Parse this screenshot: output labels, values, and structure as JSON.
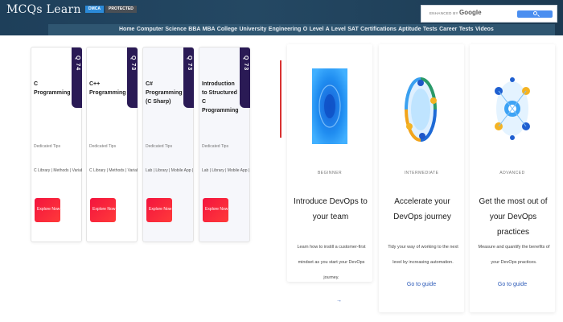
{
  "header": {
    "logo": "MCQs Learn",
    "badges": [
      "DMCA",
      "PROTECTED"
    ],
    "search_label": "ENHANCED BY",
    "search_brand": "Google",
    "nav": "Home Computer Science BBA MBA College University Engineering O Level A Level SAT Certifications Aptitude Tests Career Tests Videos"
  },
  "courses": [
    {
      "tag": "Q 74",
      "title": "C Programming",
      "meta1": "Dedicated Tips",
      "meta2": "C Library | Methods | Variables Lab",
      "button": "Explore Now"
    },
    {
      "tag": "Q 73",
      "title": "C++ Programming",
      "meta1": "Dedicated Tips",
      "meta2": "C Library | Methods | Variables Lab",
      "button": "Explore Now"
    },
    {
      "tag": "Q 73",
      "title": "C# Programming (C Sharp)",
      "meta1": "Dedicated Tips",
      "meta2": "Lab | Library | Mobile App | Web Tips",
      "button": "Explore Now"
    },
    {
      "tag": "Q 73",
      "title": "Introduction to Structured C Programming",
      "meta1": "Dedicated Tips",
      "meta2": "Lab | Library | Mobile App | Web Tips",
      "button": "Explore Now"
    }
  ],
  "guides": [
    {
      "level": "BEGINNER",
      "title": "Introduce DevOps to your team",
      "desc": "Learn how to instill a customer-first mindset as you start your DevOps journey.",
      "link": ""
    },
    {
      "level": "INTERMEDIATE",
      "title": "Accelerate your DevOps journey",
      "desc": "Tidy your way of working to the next level by increasing automation.",
      "link": "Go to guide"
    },
    {
      "level": "ADVANCED",
      "title": "Get the most out of your DevOps practices",
      "desc": "Measure and quantify the benefits of your DevOps practices.",
      "link": "Go to guide"
    }
  ],
  "more_link": "→",
  "colors": {
    "header": "#244863",
    "nav": "#2f5671",
    "tag": "#2a1a55",
    "button": "#f3143e",
    "accent": "#2c5ab8"
  }
}
